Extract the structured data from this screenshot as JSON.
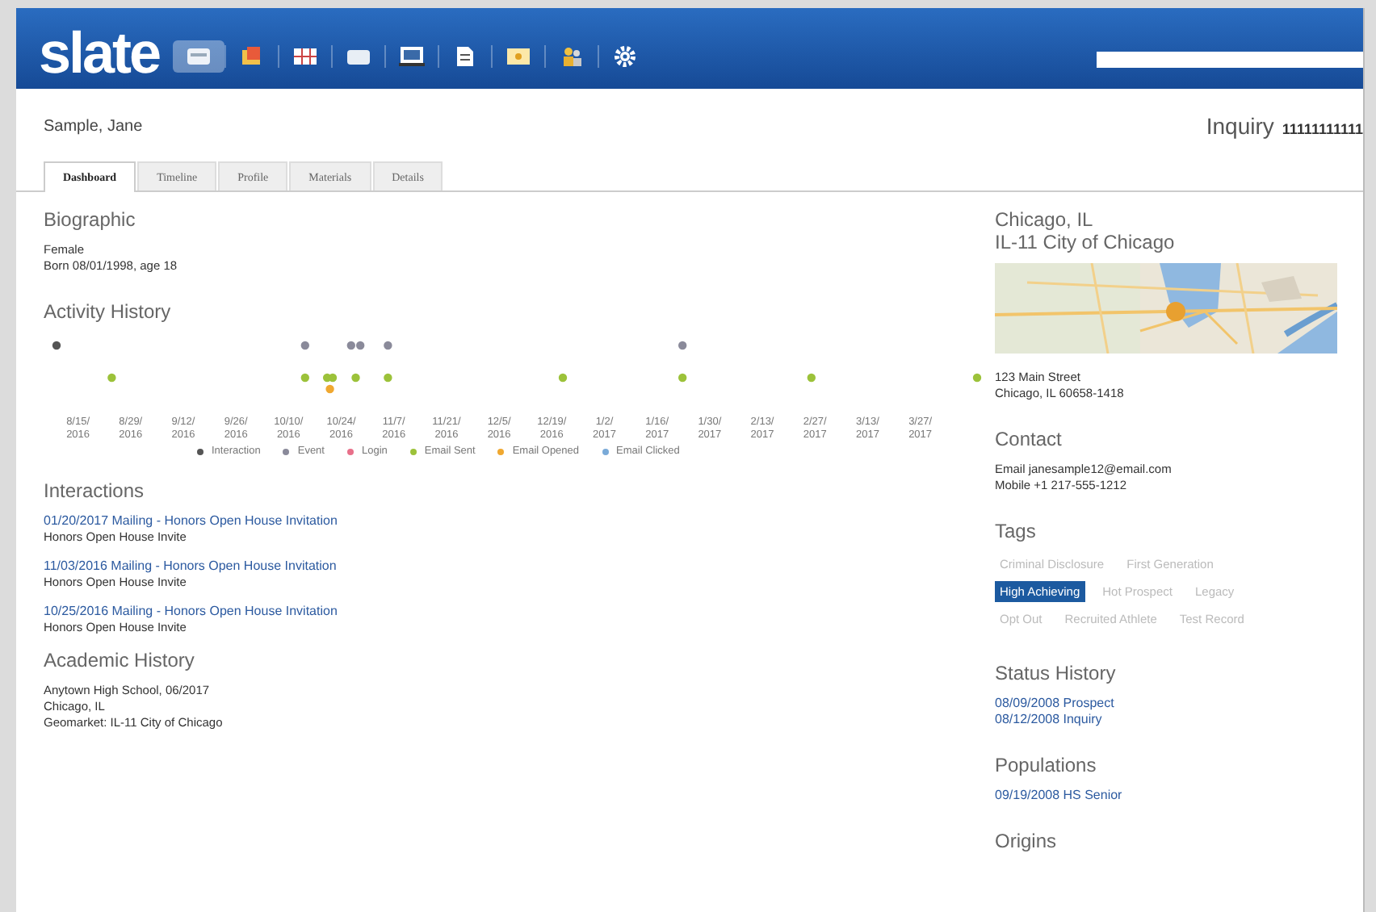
{
  "header": {
    "logo": "slate",
    "nav_icons": [
      {
        "selected": true
      },
      {
        "selected": false
      },
      {
        "selected": false
      },
      {
        "selected": false
      },
      {
        "selected": false
      },
      {
        "selected": false
      },
      {
        "selected": false
      },
      {
        "selected": false
      },
      {
        "selected": false
      }
    ]
  },
  "record": {
    "name": "Sample, Jane",
    "status": "Inquiry",
    "id": "11111111111"
  },
  "tabs": [
    {
      "label": "Dashboard",
      "selected": true
    },
    {
      "label": "Timeline",
      "selected": false
    },
    {
      "label": "Profile",
      "selected": false
    },
    {
      "label": "Materials",
      "selected": false
    },
    {
      "label": "Details",
      "selected": false
    }
  ],
  "biographic": {
    "title": "Biographic",
    "lines": [
      "Female",
      "Born 08/01/1998, age 18"
    ]
  },
  "activity_history": {
    "title": "Activity History",
    "dates": [
      "8/15/ 2016",
      "8/29/ 2016",
      "9/12/ 2016",
      "9/26/ 2016",
      "10/10/ 2016",
      "10/24/ 2016",
      "11/7/ 2016",
      "11/21/ 2016",
      "12/5/ 2016",
      "12/19/ 2016",
      "1/2/ 2017",
      "1/16/ 2017",
      "1/30/ 2017",
      "2/13/ 2017",
      "2/27/ 2017",
      "3/13/ 2017",
      "3/27/ 2017"
    ],
    "legend": [
      {
        "label": "Interaction",
        "color": "#555555"
      },
      {
        "label": "Event",
        "color": "#8a8a9a"
      },
      {
        "label": "Login",
        "color": "#e8708a"
      },
      {
        "label": "Email Sent",
        "color": "#9cc23a"
      },
      {
        "label": "Email Opened",
        "color": "#f0a830"
      },
      {
        "label": "Email Clicked",
        "color": "#7aaad8"
      }
    ]
  },
  "interactions": {
    "title": "Interactions",
    "items": [
      {
        "link": "01/20/2017 Mailing - Honors Open House Invitation",
        "detail": "Honors Open House Invite"
      },
      {
        "link": "11/03/2016 Mailing - Honors Open House Invitation",
        "detail": "Honors Open House Invite"
      },
      {
        "link": "10/25/2016 Mailing - Honors Open House Invitation",
        "detail": "Honors Open House Invite"
      }
    ]
  },
  "academic_history": {
    "title": "Academic History",
    "lines": [
      "Anytown High School, 06/2017",
      "Chicago, IL",
      "Geomarket: IL-11 City of Chicago"
    ]
  },
  "location": {
    "city": "Chicago, IL",
    "geomarket": "IL-11 City of Chicago",
    "map": {
      "kind": "picture"
    },
    "address": [
      "123 Main Street",
      "Chicago, IL 60658-1418"
    ]
  },
  "contact": {
    "title": "Contact",
    "lines": [
      "Email janesample12@email.com",
      "Mobile +1 217-555-1212"
    ]
  },
  "tags": {
    "title": "Tags",
    "items": [
      {
        "label": "Criminal Disclosure",
        "selected": false
      },
      {
        "label": "First Generation",
        "selected": false
      },
      {
        "label": "High Achieving",
        "selected": true
      },
      {
        "label": "Hot Prospect",
        "selected": false
      },
      {
        "label": "Legacy",
        "selected": false
      },
      {
        "label": "Opt Out",
        "selected": false
      },
      {
        "label": "Recruited Athlete",
        "selected": false
      },
      {
        "label": "Test Record",
        "selected": false
      }
    ]
  },
  "status_history": {
    "title": "Status History",
    "items": [
      "08/09/2008 Prospect",
      "08/12/2008 Inquiry"
    ]
  },
  "populations": {
    "title": "Populations",
    "items": [
      "09/19/2008 HS Senior"
    ]
  },
  "origins": {
    "title": "Origins"
  }
}
